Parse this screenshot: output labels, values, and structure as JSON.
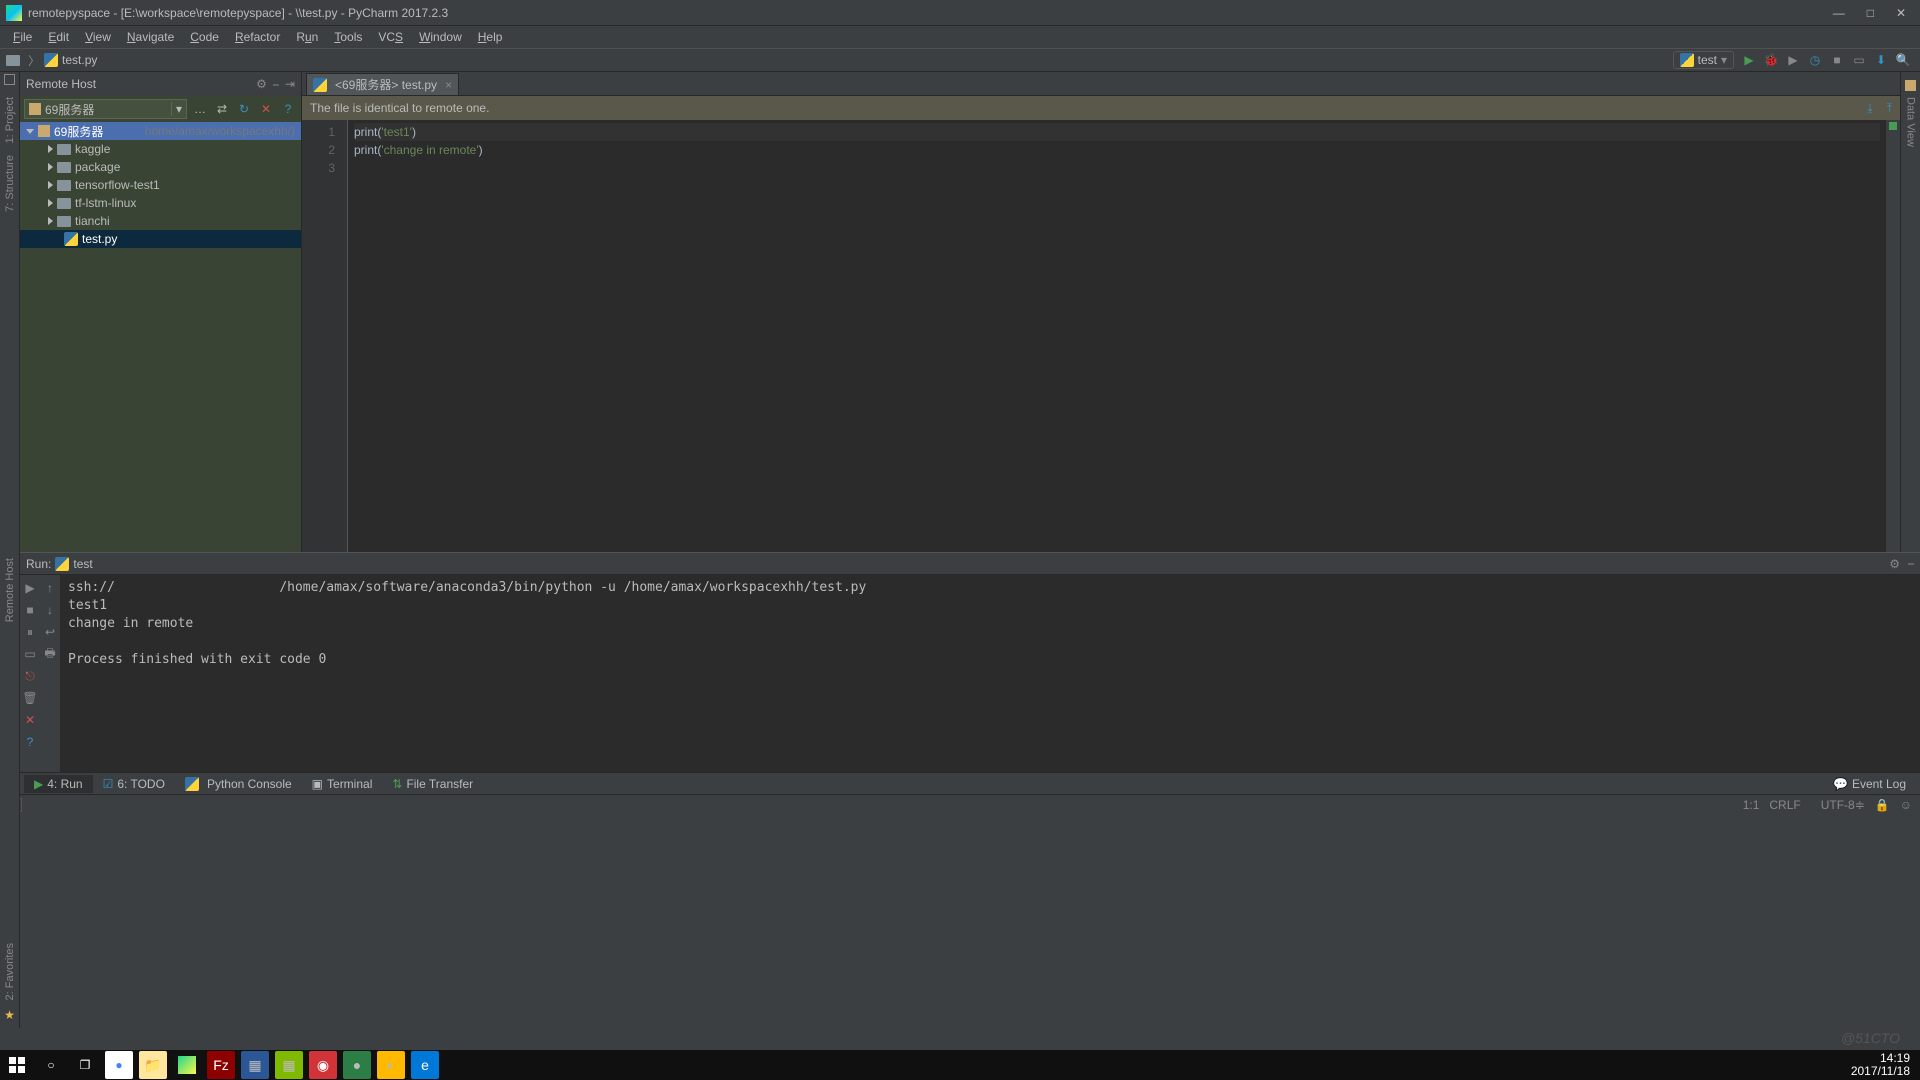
{
  "window": {
    "title": "remotepyspace - [E:\\workspace\\remotepyspace] - \\\\test.py - PyCharm 2017.2.3"
  },
  "menu": {
    "file": "File",
    "edit": "Edit",
    "view": "View",
    "navigate": "Navigate",
    "code": "Code",
    "refactor": "Refactor",
    "run": "Run",
    "tools": "Tools",
    "vcs": "VCS",
    "window": "Window",
    "help": "Help"
  },
  "breadcrumb": {
    "file": "test.py"
  },
  "runconfig": {
    "name": "test"
  },
  "remotehost": {
    "title": "Remote Host",
    "server": "69服务器",
    "root": "69服务器",
    "root_hint": "home/amax/workspacexhh/)",
    "items": [
      {
        "name": "kaggle",
        "type": "folder"
      },
      {
        "name": "package",
        "type": "folder"
      },
      {
        "name": "tensorflow-test1",
        "type": "folder"
      },
      {
        "name": "tf-lstm-linux",
        "type": "folder"
      },
      {
        "name": "tianchi",
        "type": "folder"
      }
    ],
    "selected": "test.py"
  },
  "tab": {
    "label": "<69服务器> test.py"
  },
  "banner": {
    "msg": "The file is identical to remote one."
  },
  "code": {
    "lines": [
      {
        "n": "1",
        "pre": "print(",
        "str": "'test1'",
        "post": ")"
      },
      {
        "n": "2",
        "pre": "print(",
        "str": "'change in remote'",
        "post": ")"
      },
      {
        "n": "3",
        "pre": "",
        "str": "",
        "post": ""
      }
    ]
  },
  "run": {
    "label": "Run:",
    "name": "test",
    "output": "ssh://                     /home/amax/software/anaconda3/bin/python -u /home/amax/workspacexhh/test.py\ntest1\nchange in remote\n\nProcess finished with exit code 0"
  },
  "bottomtabs": {
    "run": "4: Run",
    "todo": "6: TODO",
    "pyconsole": "Python Console",
    "terminal": "Terminal",
    "ftransfer": "File Transfer",
    "eventlog": "Event Log"
  },
  "status": {
    "pos": "1:1",
    "crlf": "CRLF",
    "enc": "UTF-8",
    "lock": "⇕"
  },
  "left_gutter": {
    "project": "1: Project",
    "structure": "7: Structure",
    "remotehost": "Remote Host",
    "favorites": "2: Favorites"
  },
  "right_gutter": {
    "dbview": "Data View"
  },
  "taskbar": {
    "time": "14:19",
    "date": "2017/11/18"
  },
  "watermark": "@51CTO"
}
